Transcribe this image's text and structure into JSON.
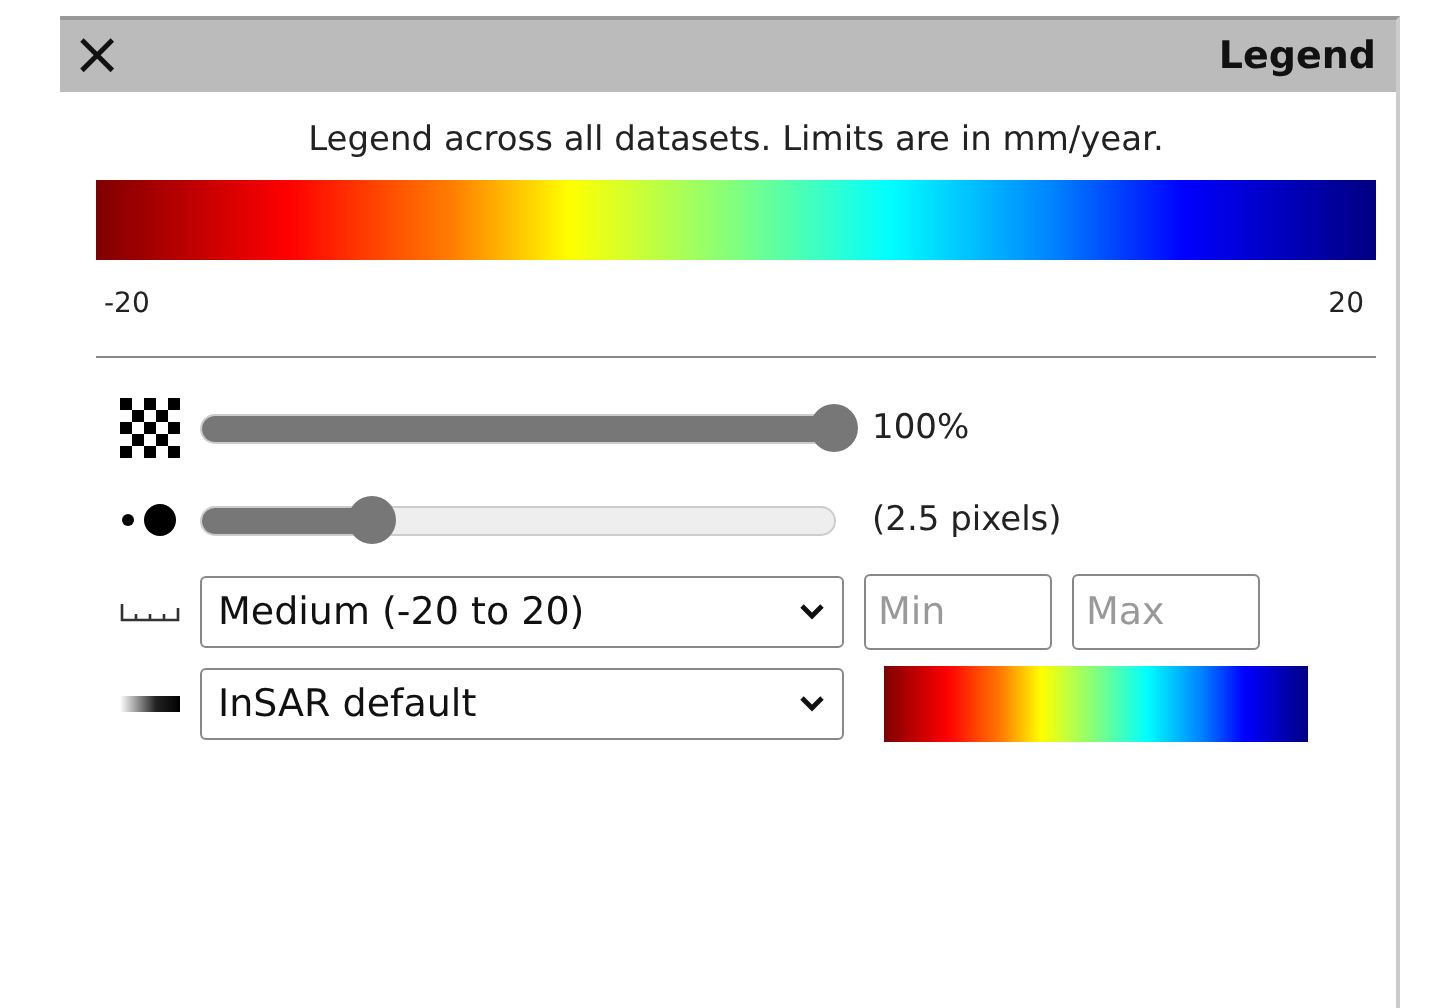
{
  "header": {
    "close": "×",
    "title": "Legend"
  },
  "description": "Legend across all datasets. Limits are in mm/year.",
  "colorbar": {
    "min": "-20",
    "max": "20"
  },
  "opacity": {
    "level": 1.0,
    "reading": "100%"
  },
  "point_size": {
    "level": 0.27,
    "reading": "(2.5 pixels)"
  },
  "range": {
    "value": "Medium (-20 to 20)",
    "min_placeholder": "Min",
    "max_placeholder": "Max"
  },
  "colormap": {
    "value": "InSAR default"
  }
}
